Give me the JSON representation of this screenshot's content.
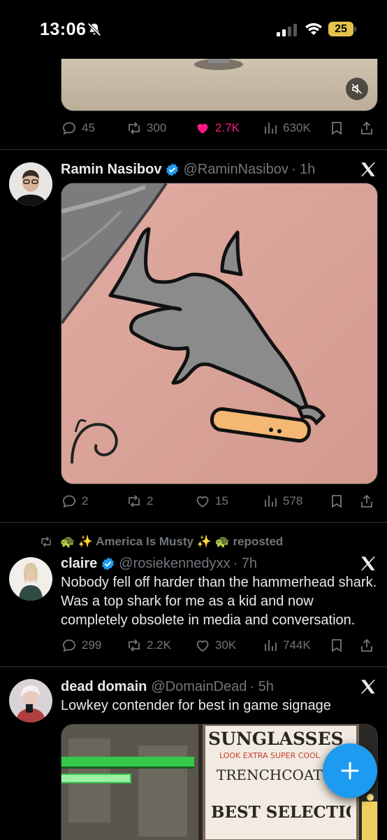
{
  "status_bar": {
    "time": "13:06",
    "battery": "25"
  },
  "post1": {
    "actions": {
      "replies": "45",
      "reposts": "300",
      "likes": "2.7K",
      "views": "630K"
    },
    "colors": {
      "like_active": "#f91880"
    }
  },
  "post2": {
    "name": "Ramin Nasibov",
    "handle": "@RaminNasibov",
    "time": "· 1h",
    "actions": {
      "replies": "2",
      "reposts": "2",
      "likes": "15",
      "views": "578"
    }
  },
  "post3": {
    "repost_label": "🐢 ✨ America Is Musty ✨ 🐢  reposted",
    "name": "claire",
    "handle": "@rosiekennedyxx",
    "time": "· 7h",
    "text": "Nobody fell off harder than the hammerhead shark. Was a top shark for me as a kid and now completely obsolete in media and conversation.",
    "actions": {
      "replies": "299",
      "reposts": "2.2K",
      "likes": "30K",
      "views": "744K"
    }
  },
  "post4": {
    "name": "dead domain",
    "handle": "@DomainDead",
    "time": "· 5h",
    "text": "Lowkey contender for best in game signage",
    "sign": {
      "line1": "SUNGLASSES",
      "line2": "LOOK EXTRA SUPER COOL",
      "line3": "TRENCHCOATS",
      "line4": "BEST SELECTION"
    }
  },
  "colors": {
    "accent": "#1d9bf0",
    "muted": "#71767b",
    "text": "#e7e9ea",
    "divider": "#2f3336"
  },
  "icons": [
    "reply-icon",
    "repost-icon",
    "like-icon",
    "views-icon",
    "bookmark-icon",
    "share-icon",
    "verified-badge-icon",
    "x-logo-icon",
    "mute-icon",
    "compose-plus-icon"
  ]
}
